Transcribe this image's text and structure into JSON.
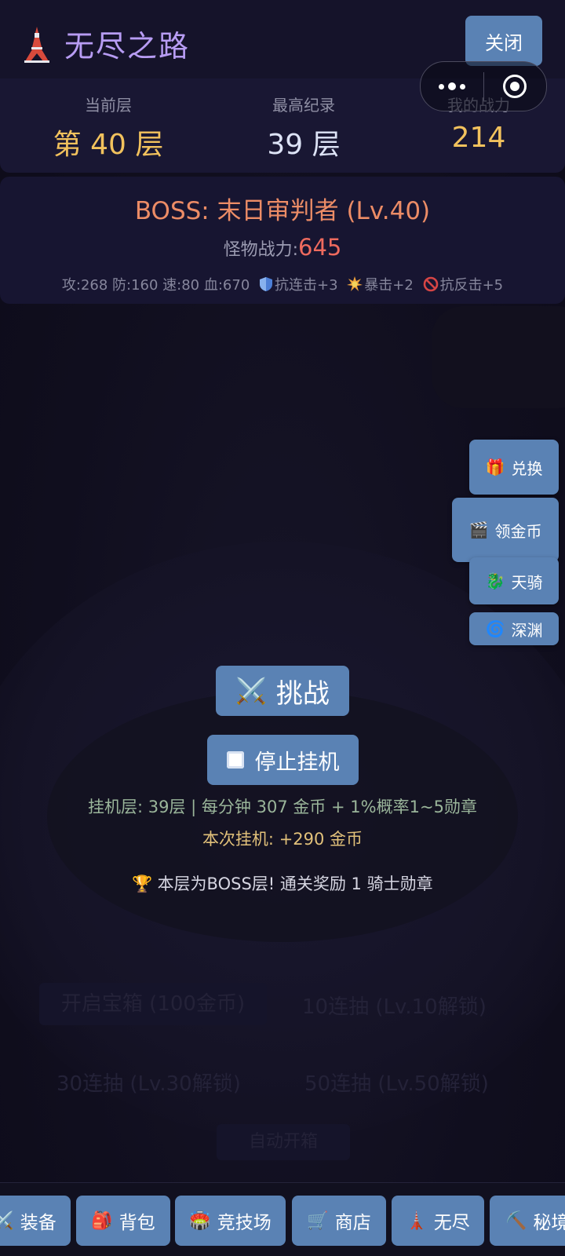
{
  "header": {
    "title": "无尽之路",
    "close_label": "关闭"
  },
  "stats": {
    "current_floor_label": "当前层",
    "current_floor_value": "第 40 层",
    "best_record_label": "最高纪录",
    "best_record_value": "39 层",
    "my_power_label": "我的战力",
    "my_power_value": "214"
  },
  "boss": {
    "name": "BOSS: 末日审判者 (Lv.40)",
    "power_label": "怪物战力:",
    "power_value": "645",
    "base_attrs": "攻:268 防:160 速:80 血:670",
    "anti_combo": "抗连击+3",
    "crit": "暴击+2",
    "anti_counter": "抗反击+5"
  },
  "side_buttons": [
    {
      "icon": "gift-icon",
      "glyph": "🎁",
      "label": "兑换"
    },
    {
      "icon": "clapper-icon",
      "glyph": "🎬",
      "label": "领金币"
    },
    {
      "icon": "dragon-icon",
      "glyph": "🐉",
      "label": "天骑"
    },
    {
      "icon": "spiral-icon",
      "glyph": "🌀",
      "label": "深渊"
    }
  ],
  "actions": {
    "challenge_glyph": "⚔️",
    "challenge_label": "挑战",
    "stop_label": "停止挂机"
  },
  "idle": {
    "info": "挂机层: 39层 | 每分钟 307 金币 + 1%概率1~5勋章",
    "gain": "本次挂机: +290 金币",
    "boss_reward_glyph": "🏆",
    "boss_reward": "本层为BOSS层! 通关奖励 1 骑士勋章"
  },
  "bottom_nav": [
    {
      "icon": "swords-icon",
      "glyph": "⚔️",
      "label": "装备"
    },
    {
      "icon": "backpack-icon",
      "glyph": "🎒",
      "label": "背包"
    },
    {
      "icon": "stadium-icon",
      "glyph": "🏟️",
      "label": "竞技场"
    },
    {
      "icon": "cart-icon",
      "glyph": "🛒",
      "label": "商店"
    },
    {
      "icon": "tower-icon",
      "glyph": "🗼",
      "label": "无尽"
    },
    {
      "icon": "pickaxe-icon",
      "glyph": "⛏️",
      "label": "秘境"
    }
  ],
  "background_ghost": {
    "open_box": "开启宝箱 (100金币)",
    "ten_draw": "10连抽 (Lv.10解锁)",
    "thirty_draw": "30连抽 (Lv.30解锁)",
    "fifty_draw": "50连抽 (Lv.50解锁)",
    "auto_open": "自动开箱"
  },
  "colors": {
    "button": "#5a82b4",
    "title": "#b79cf3",
    "gold": "#f2c25d",
    "boss_name": "#ec8c66",
    "boss_power": "#ee6a5e"
  }
}
